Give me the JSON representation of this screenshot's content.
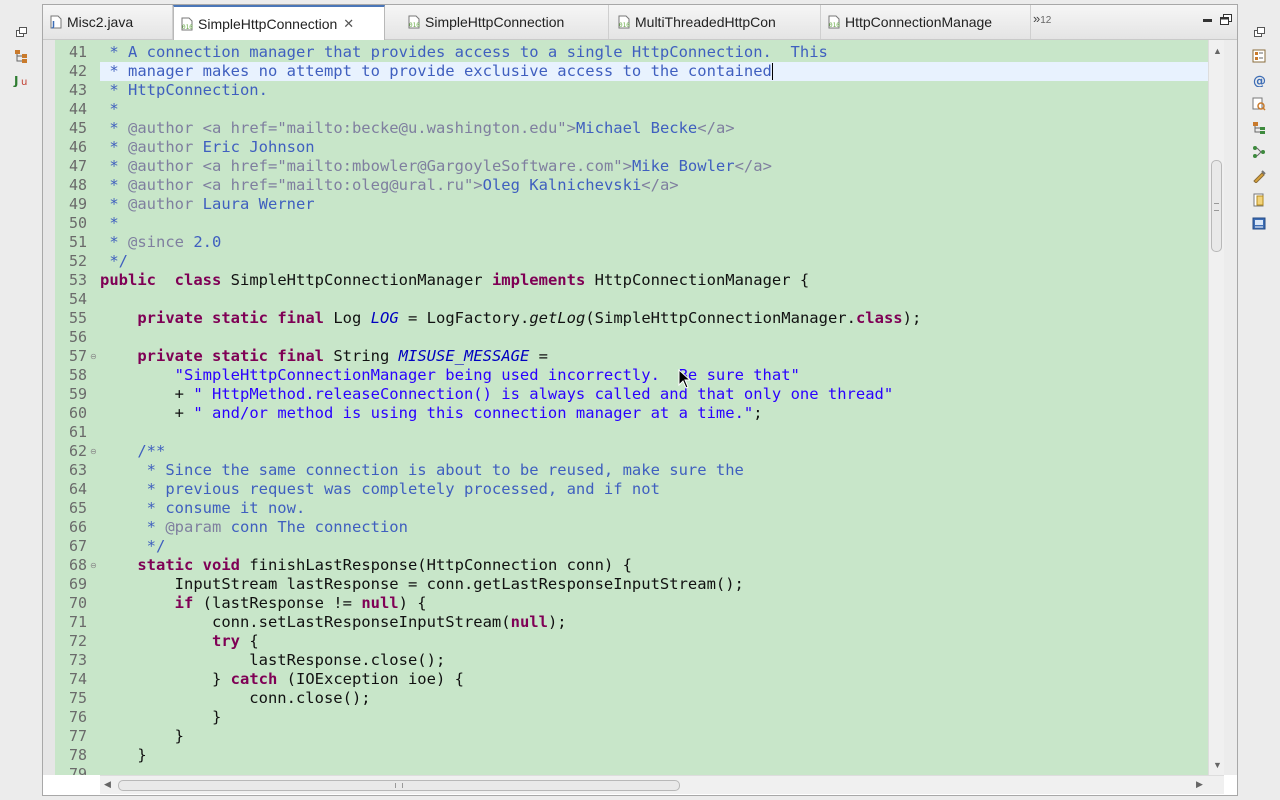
{
  "tabs": [
    {
      "label": "Misc2.java",
      "active": false
    },
    {
      "label": "SimpleHttpConnection",
      "active": true
    },
    {
      "label": "SimpleHttpConnection",
      "active": false
    },
    {
      "label": "MultiThreadedHttpCon",
      "active": false
    },
    {
      "label": "HttpConnectionManage",
      "active": false
    }
  ],
  "tab_overflow": {
    "chevron": "»",
    "count": "12"
  },
  "colors": {
    "editor_background": "#c8e6c9",
    "current_line": "#e8f2fe",
    "keyword": "#7f0055",
    "comment": "#3f5fbf",
    "string": "#2a00ff",
    "static_field": "#0000c0"
  },
  "icons": {
    "left_trim": [
      "restore-icon",
      "hierarchy-icon",
      "junit-icon"
    ],
    "right_trim": [
      "restore-icon",
      "outline-icon",
      "annotation-icon",
      "search-icon",
      "type-hierarchy-icon",
      "call-hierarchy-icon",
      "tasks-icon",
      "bookmarks-icon",
      "console-icon"
    ],
    "window": [
      "minimize-icon",
      "maximize-icon"
    ]
  },
  "editor": {
    "line_numbers": [
      "41",
      "42",
      "43",
      "44",
      "45",
      "46",
      "47",
      "48",
      "49",
      "50",
      "51",
      "52",
      "53",
      "54",
      "55",
      "56",
      "57",
      "58",
      "59",
      "60",
      "61",
      "62",
      "63",
      "64",
      "65",
      "66",
      "67",
      "68",
      "69",
      "70",
      "71",
      "72",
      "73",
      "74",
      "75",
      "76",
      "77",
      "78",
      "79"
    ],
    "fold_markers": [
      "57",
      "62",
      "68"
    ],
    "current_line": "42",
    "lines": [
      [
        [
          "cm",
          " * A connection manager that provides access to a single HttpConnection.  This"
        ]
      ],
      [
        [
          "cm",
          " * manager makes no attempt to provide exclusive access to the contained"
        ]
      ],
      [
        [
          "cm",
          " * HttpConnection."
        ]
      ],
      [
        [
          "cm",
          " *"
        ]
      ],
      [
        [
          "cm",
          " * "
        ],
        [
          "tag",
          "@author"
        ],
        [
          "cm",
          " "
        ],
        [
          "tag",
          "<a href=\"mailto:becke@u.washington.edu\">"
        ],
        [
          "cm",
          "Michael Becke"
        ],
        [
          "tag",
          "</a>"
        ]
      ],
      [
        [
          "cm",
          " * "
        ],
        [
          "tag",
          "@author"
        ],
        [
          "cm",
          " Eric Johnson"
        ]
      ],
      [
        [
          "cm",
          " * "
        ],
        [
          "tag",
          "@author"
        ],
        [
          "cm",
          " "
        ],
        [
          "tag",
          "<a href=\"mailto:mbowler@GargoyleSoftware.com\">"
        ],
        [
          "cm",
          "Mike Bowler"
        ],
        [
          "tag",
          "</a>"
        ]
      ],
      [
        [
          "cm",
          " * "
        ],
        [
          "tag",
          "@author"
        ],
        [
          "cm",
          " "
        ],
        [
          "tag",
          "<a href=\"mailto:oleg@ural.ru\">"
        ],
        [
          "cm",
          "Oleg Kalnichevski"
        ],
        [
          "tag",
          "</a>"
        ]
      ],
      [
        [
          "cm",
          " * "
        ],
        [
          "tag",
          "@author"
        ],
        [
          "cm",
          " Laura Werner"
        ]
      ],
      [
        [
          "cm",
          " *"
        ]
      ],
      [
        [
          "cm",
          " * "
        ],
        [
          "tag",
          "@since"
        ],
        [
          "cm",
          " 2.0"
        ]
      ],
      [
        [
          "cm",
          " */"
        ]
      ],
      [
        [
          "kw",
          "public"
        ],
        [
          "",
          "  "
        ],
        [
          "kw",
          "class"
        ],
        [
          "",
          " SimpleHttpConnectionManager "
        ],
        [
          "kw",
          "implements"
        ],
        [
          "",
          " HttpConnectionManager {"
        ]
      ],
      [],
      [
        [
          "",
          "    "
        ],
        [
          "kw",
          "private"
        ],
        [
          "",
          " "
        ],
        [
          "kw",
          "static"
        ],
        [
          "",
          " "
        ],
        [
          "kw",
          "final"
        ],
        [
          "",
          " Log "
        ],
        [
          "sf",
          "LOG"
        ],
        [
          "",
          " = LogFactory."
        ],
        [
          "it",
          "getLog"
        ],
        [
          "",
          "(SimpleHttpConnectionManager."
        ],
        [
          "kw",
          "class"
        ],
        [
          "",
          ");"
        ]
      ],
      [],
      [
        [
          "",
          "    "
        ],
        [
          "kw",
          "private"
        ],
        [
          "",
          " "
        ],
        [
          "kw",
          "static"
        ],
        [
          "",
          " "
        ],
        [
          "kw",
          "final"
        ],
        [
          "",
          " String "
        ],
        [
          "sf",
          "MISUSE_MESSAGE"
        ],
        [
          "",
          " ="
        ]
      ],
      [
        [
          "",
          "        "
        ],
        [
          "str",
          "\"SimpleHttpConnectionManager being used incorrectly.  Be sure that\""
        ]
      ],
      [
        [
          "",
          "        + "
        ],
        [
          "str",
          "\" HttpMethod.releaseConnection() is always called and that only one thread\""
        ]
      ],
      [
        [
          "",
          "        + "
        ],
        [
          "str",
          "\" and/or method is using this connection manager at a time.\""
        ],
        [
          "",
          ";"
        ]
      ],
      [],
      [
        [
          "cm",
          "    /**"
        ]
      ],
      [
        [
          "cm",
          "     * Since the same connection is about to be reused, make sure the"
        ]
      ],
      [
        [
          "cm",
          "     * previous request was completely processed, and if not"
        ]
      ],
      [
        [
          "cm",
          "     * consume it now."
        ]
      ],
      [
        [
          "cm",
          "     * "
        ],
        [
          "tag",
          "@param"
        ],
        [
          "cm",
          " conn The connection"
        ]
      ],
      [
        [
          "cm",
          "     */"
        ]
      ],
      [
        [
          "",
          "    "
        ],
        [
          "kw",
          "static"
        ],
        [
          "",
          " "
        ],
        [
          "kw",
          "void"
        ],
        [
          "",
          " finishLastResponse(HttpConnection conn) {"
        ]
      ],
      [
        [
          "",
          "        InputStream lastResponse = conn.getLastResponseInputStream();"
        ]
      ],
      [
        [
          "",
          "        "
        ],
        [
          "kw",
          "if"
        ],
        [
          "",
          " (lastResponse != "
        ],
        [
          "kw",
          "null"
        ],
        [
          "",
          ") {"
        ]
      ],
      [
        [
          "",
          "            conn.setLastResponseInputStream("
        ],
        [
          "kw",
          "null"
        ],
        [
          "",
          ");"
        ]
      ],
      [
        [
          "",
          "            "
        ],
        [
          "kw",
          "try"
        ],
        [
          "",
          " {"
        ]
      ],
      [
        [
          "",
          "                lastResponse.close();"
        ]
      ],
      [
        [
          "",
          "            } "
        ],
        [
          "kw",
          "catch"
        ],
        [
          "",
          " (IOException ioe) {"
        ]
      ],
      [
        [
          "",
          "                conn.close();"
        ]
      ],
      [
        [
          "",
          "            }"
        ]
      ],
      [
        [
          "",
          "        }"
        ]
      ],
      [
        [
          "",
          "    }"
        ]
      ],
      []
    ]
  }
}
